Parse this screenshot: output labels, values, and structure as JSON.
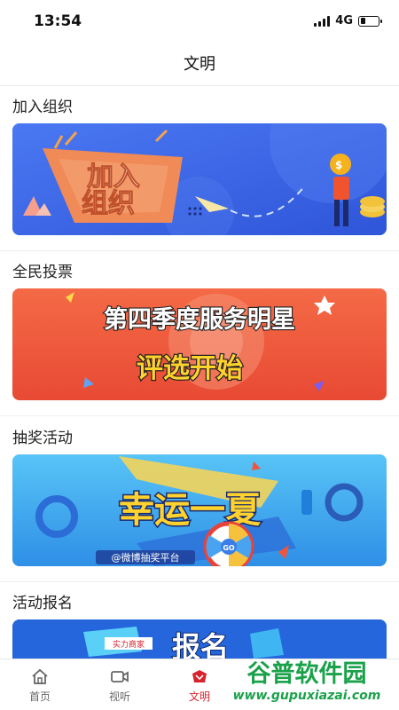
{
  "status_bar": {
    "time": "13:54",
    "network": "4G",
    "signal_bars": 4,
    "battery_level": 0.3
  },
  "nav": {
    "title": "文明"
  },
  "sections": [
    {
      "title": "加入组织",
      "banner": {
        "text": "加入组织",
        "icon": "join-organization-banner"
      }
    },
    {
      "title": "全民投票",
      "banner": {
        "line1": "第四季度服务明星",
        "line2": "评选开始",
        "icon": "vote-banner"
      }
    },
    {
      "title": "抽奖活动",
      "banner": {
        "headline": "幸运一夏",
        "sub": "@微博抽奖平台",
        "wheel_label": "GO",
        "icon": "lottery-banner"
      }
    },
    {
      "title": "活动报名",
      "banner": {
        "headline": "报名",
        "tag": "实力商家",
        "icon": "signup-banner"
      }
    }
  ],
  "tabbar": {
    "items": [
      {
        "label": "首页",
        "icon": "home-icon",
        "active": false
      },
      {
        "label": "视听",
        "icon": "video-icon",
        "active": false
      },
      {
        "label": "文明",
        "icon": "civilization-icon",
        "active": true
      }
    ]
  },
  "watermark": {
    "title": "谷普软件园",
    "url": "www.gupuxiazai.com"
  },
  "colors": {
    "accent": "#d7232e",
    "banner1_bg": "#3b66ea",
    "banner2_bg": "#ef5a3b",
    "banner3_bg": "#43aef0",
    "banner4_bg": "#1f5ed8"
  }
}
